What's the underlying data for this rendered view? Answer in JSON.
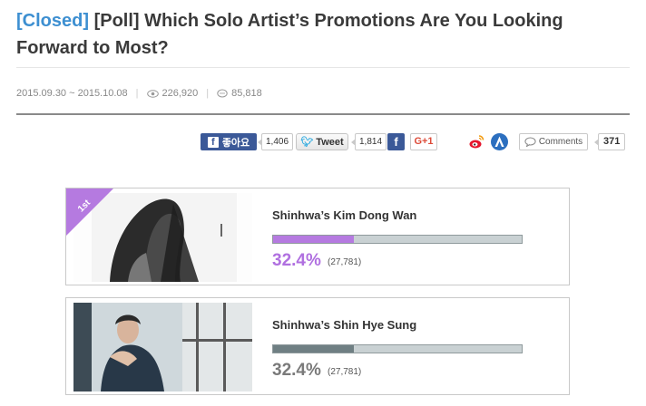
{
  "header": {
    "status": "[Closed]",
    "title": "[Poll] Which Solo Artist’s Promotions Are You Looking Forward to Most?",
    "status_color": "#3d8fd1"
  },
  "meta": {
    "dates": "2015.09.30 ~ 2015.10.08",
    "views": "226,920",
    "comments": "85,818"
  },
  "share": {
    "facebook_label": "좋아요",
    "facebook_count": "1,406",
    "tweet_label": "Tweet",
    "tweet_count": "1,814",
    "facebook_icon": "facebook-icon",
    "gplus_label": "G+1",
    "weibo_icon": "weibo-icon",
    "extra_icon": "share-a-icon",
    "comments_label": "Comments",
    "comments_count": "371"
  },
  "poll": [
    {
      "rank": "1st",
      "name": "Shinhwa’s Kim Dong Wan",
      "percent_label": "32.4%",
      "votes": "(27,781)",
      "fill_fraction": 0.324,
      "bar_color": "#b57ae0",
      "pct_color": "#b070e0",
      "ribbon_color": "#b57ae0"
    },
    {
      "name": "Shinhwa’s Shin Hye Sung",
      "percent_label": "32.4%",
      "votes": "(27,781)",
      "fill_fraction": 0.324,
      "bar_color": "#6f7f83",
      "pct_color": "#7a7a7a"
    }
  ]
}
